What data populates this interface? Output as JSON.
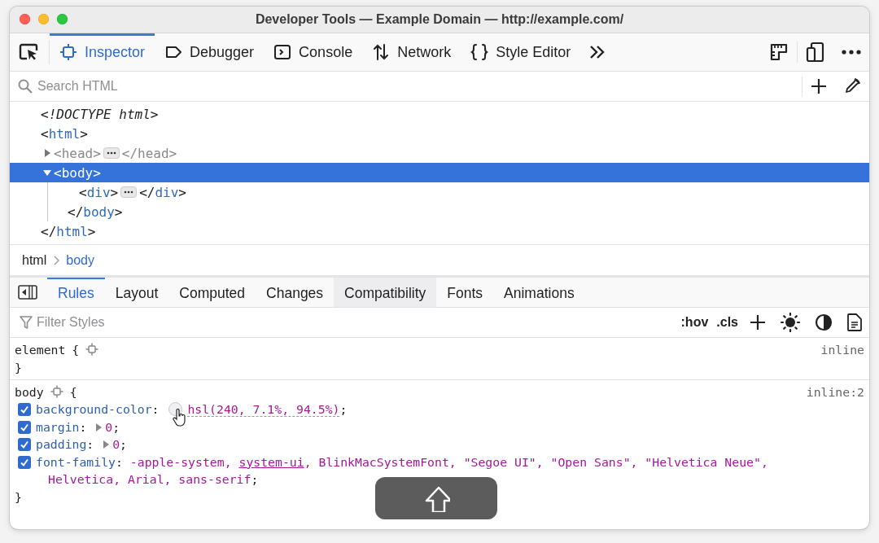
{
  "window": {
    "title": "Developer Tools — Example Domain — http://example.com/"
  },
  "toolbar": {
    "tabs": [
      {
        "label": "Inspector",
        "kind": "inspector",
        "selected": true
      },
      {
        "label": "Debugger",
        "kind": "debugger",
        "selected": false
      },
      {
        "label": "Console",
        "kind": "console",
        "selected": false
      },
      {
        "label": "Network",
        "kind": "network",
        "selected": false
      },
      {
        "label": "Style Editor",
        "kind": "styles",
        "selected": false
      }
    ]
  },
  "markup": {
    "search": {
      "placeholder": "Search HTML"
    },
    "nodes": [
      {
        "kind": "doctype",
        "text": "<!DOCTYPE html>"
      },
      {
        "kind": "element",
        "open": "<html>",
        "close": "</html>",
        "expanded": true,
        "selected": false,
        "dimmed": false,
        "children": [
          {
            "kind": "element",
            "open": "<head>",
            "close": "</head>",
            "expanded": false,
            "selected": false,
            "dimmed": true
          },
          {
            "kind": "element",
            "open": "<body>",
            "close": "</body>",
            "expanded": true,
            "selected": true,
            "dimmed": false,
            "children": [
              {
                "kind": "element",
                "open": "<div>",
                "close": "</div>",
                "expanded": false,
                "selected": false,
                "dimmed": false
              }
            ]
          }
        ]
      }
    ]
  },
  "breadcrumbs": [
    {
      "label": "html",
      "selected": false
    },
    {
      "label": "body",
      "selected": true
    }
  ],
  "sidebar": {
    "tabs": [
      {
        "label": "Rules",
        "selected": true,
        "hovered": false
      },
      {
        "label": "Layout",
        "selected": false,
        "hovered": false
      },
      {
        "label": "Computed",
        "selected": false,
        "hovered": false
      },
      {
        "label": "Changes",
        "selected": false,
        "hovered": false
      },
      {
        "label": "Compatibility",
        "selected": false,
        "hovered": true
      },
      {
        "label": "Fonts",
        "selected": false,
        "hovered": false
      },
      {
        "label": "Animations",
        "selected": false,
        "hovered": false
      }
    ],
    "filter": {
      "placeholder": "Filter Styles"
    },
    "toggles": [
      ":hov",
      ".cls"
    ]
  },
  "rules": [
    {
      "selector": "element",
      "source": "inline",
      "open": "{",
      "close": "}"
    },
    {
      "selector": "body",
      "source": "inline:2",
      "open": "{",
      "close": "}",
      "declarations": [
        {
          "property": "background-color",
          "colon": ":",
          "semicolon": ";",
          "kind": "color",
          "enabled": true,
          "parts": [
            {
              "text": "hsl(240, 7.1%, 94.5%)",
              "underlined": false
            }
          ]
        },
        {
          "property": "margin",
          "colon": ":",
          "semicolon": ";",
          "kind": "expandable",
          "enabled": true,
          "parts": [
            {
              "text": "0",
              "underlined": false
            }
          ]
        },
        {
          "property": "padding",
          "colon": ":",
          "semicolon": ";",
          "kind": "expandable",
          "enabled": true,
          "parts": [
            {
              "text": "0",
              "underlined": false
            }
          ]
        },
        {
          "property": "font-family",
          "colon": ":",
          "semicolon": ";",
          "kind": "plain",
          "enabled": true,
          "parts": [
            {
              "text": "-apple-system, ",
              "underlined": false
            },
            {
              "text": "system-ui",
              "underlined": true
            },
            {
              "text": ", BlinkMacSystemFont, \"Segoe UI\", \"Open Sans\", \"Helvetica Neue\", Helvetica, Arial, sans-serif",
              "underlined": false
            }
          ]
        }
      ]
    }
  ]
}
